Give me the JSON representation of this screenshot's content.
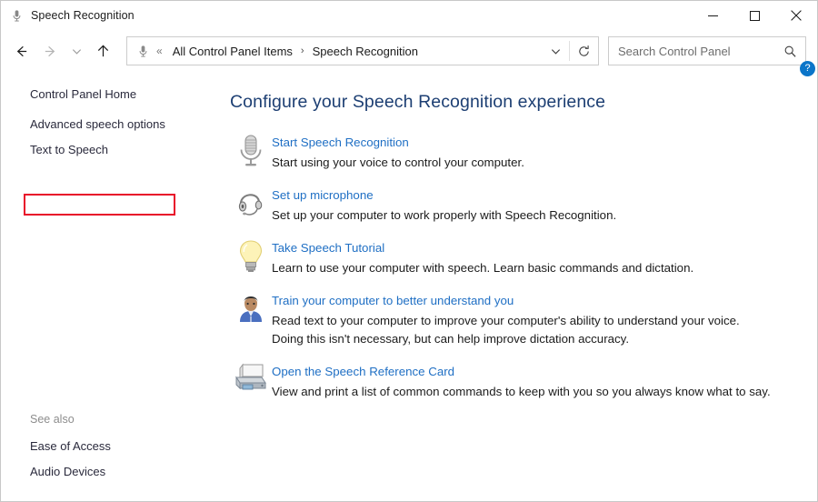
{
  "window": {
    "title": "Speech Recognition",
    "title_icon": "microphone-icon",
    "minimize_label": "—",
    "maximize_label": "□",
    "close_label": "✕"
  },
  "toolbar": {
    "back_icon": "arrow-left-icon",
    "forward_icon": "arrow-right-icon",
    "recent_icon": "chevron-down-icon",
    "up_icon": "arrow-up-icon",
    "address": {
      "icon": "microphone-icon",
      "overflow": "«",
      "separator": "›",
      "crumbs": [
        "All Control Panel Items",
        "Speech Recognition"
      ],
      "dropdown_icon": "chevron-down-icon",
      "refresh_icon": "refresh-icon"
    },
    "search": {
      "placeholder": "Search Control Panel",
      "value": "",
      "icon": "search-icon"
    }
  },
  "sidebar": {
    "home_label": "Control Panel Home",
    "items": [
      {
        "label": "Advanced speech options",
        "highlighted": true
      },
      {
        "label": "Text to Speech",
        "highlighted": false
      }
    ],
    "see_also": {
      "title": "See also",
      "items": [
        {
          "label": "Ease of Access"
        },
        {
          "label": "Audio Devices"
        }
      ]
    }
  },
  "main": {
    "heading": "Configure your Speech Recognition experience",
    "help_label": "?",
    "help_icon": "help-circle-icon",
    "tasks": [
      {
        "icon": "microphone-icon",
        "link": "Start Speech Recognition",
        "description": "Start using your voice to control your computer."
      },
      {
        "icon": "headset-icon",
        "link": "Set up microphone",
        "description": "Set up your computer to work properly with Speech Recognition."
      },
      {
        "icon": "lightbulb-icon",
        "link": "Take Speech Tutorial",
        "description": "Learn to use your computer with speech.  Learn basic commands and dictation."
      },
      {
        "icon": "person-icon",
        "link": "Train your computer to better understand you",
        "description": "Read text to your computer to improve your computer's ability to understand your voice.\nDoing this isn't necessary, but can help improve dictation accuracy."
      },
      {
        "icon": "printer-icon",
        "link": "Open the Speech Reference Card",
        "description": "View and print a list of common commands to keep with you so you always know what to say."
      }
    ]
  },
  "colors": {
    "heading": "#1d3f73",
    "link": "#1f6fc4",
    "highlight_border": "#e8102a",
    "help_badge": "#0b75c9"
  }
}
